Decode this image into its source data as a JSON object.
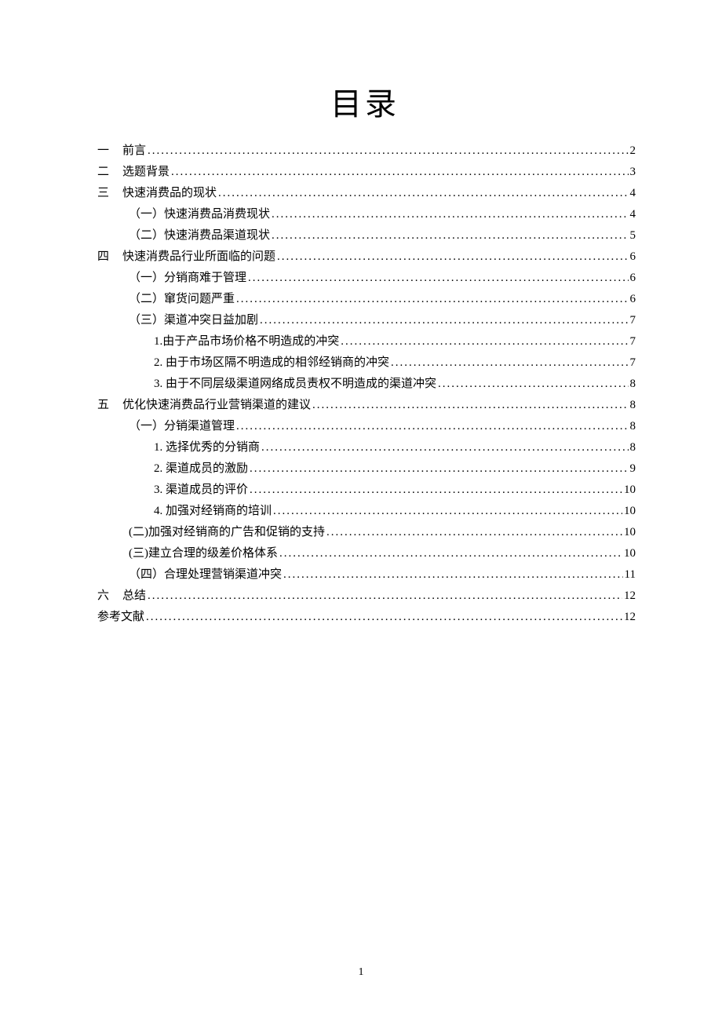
{
  "title": "目录",
  "toc": [
    {
      "num": "一",
      "label": "前言",
      "page": "2",
      "indent": 0
    },
    {
      "num": "二",
      "label": "选题背景",
      "page": "3",
      "indent": 0
    },
    {
      "num": "三",
      "label": "快速消费品的现状",
      "page": "4",
      "indent": 0
    },
    {
      "num": "",
      "label": "（一）快速消费品消费现状",
      "page": "4",
      "indent": 1
    },
    {
      "num": "",
      "label": "（二）快速消费品渠道现状",
      "page": "5",
      "indent": 1
    },
    {
      "num": "四",
      "label": "快速消费品行业所面临的问题",
      "page": "6",
      "indent": 0
    },
    {
      "num": "",
      "label": "（一）分销商难于管理",
      "page": "6",
      "indent": 1
    },
    {
      "num": "",
      "label": "（二）窜货问题严重",
      "page": "6",
      "indent": 1
    },
    {
      "num": "",
      "label": "（三）渠道冲突日益加剧",
      "page": "7",
      "indent": 1
    },
    {
      "num": "",
      "label": "1.由于产品市场价格不明造成的冲突",
      "page": "7",
      "indent": 2
    },
    {
      "num": "",
      "label": "2. 由于市场区隔不明造成的相邻经销商的冲突",
      "page": "7",
      "indent": 2
    },
    {
      "num": "",
      "label": "3. 由于不同层级渠道网络成员责权不明造成的渠道冲突",
      "page": "8",
      "indent": 2
    },
    {
      "num": "五",
      "label": "优化快速消费品行业营销渠道的建议",
      "page": "8",
      "indent": 0
    },
    {
      "num": "",
      "label": "（一）分销渠道管理",
      "page": "8",
      "indent": 1
    },
    {
      "num": "",
      "label": "1. 选择优秀的分销商",
      "page": "8",
      "indent": 2
    },
    {
      "num": "",
      "label": "2. 渠道成员的激励",
      "page": "9",
      "indent": 2
    },
    {
      "num": "",
      "label": "3. 渠道成员的评价",
      "page": "10",
      "indent": 2
    },
    {
      "num": "",
      "label": "4. 加强对经销商的培训",
      "page": "10",
      "indent": 2
    },
    {
      "num": "",
      "label": "(二)加强对经销商的广告和促销的支持",
      "page": "10",
      "indent": 1
    },
    {
      "num": "",
      "label": "(三)建立合理的级差价格体系",
      "page": "10",
      "indent": 1
    },
    {
      "num": "",
      "label": "（四）合理处理营销渠道冲突",
      "page": "11",
      "indent": 1
    },
    {
      "num": "六",
      "label": "总结",
      "page": "12",
      "indent": 0
    },
    {
      "num": "REF",
      "label": "参考文献",
      "page": "12",
      "indent": 0
    }
  ],
  "footer_page": "1"
}
